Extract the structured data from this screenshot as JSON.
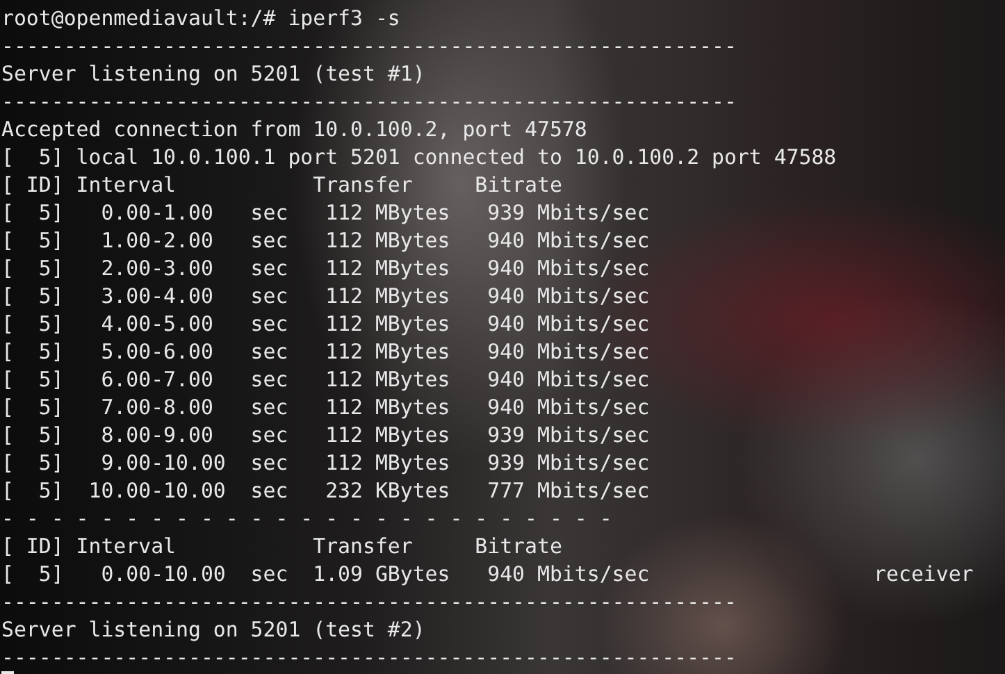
{
  "terminal": {
    "lines": [
      "root@openmediavault:/# iperf3 -s",
      "-----------------------------------------------------------",
      "Server listening on 5201 (test #1)",
      "-----------------------------------------------------------",
      "Accepted connection from 10.0.100.2, port 47578",
      "[  5] local 10.0.100.1 port 5201 connected to 10.0.100.2 port 47588",
      "[ ID] Interval           Transfer     Bitrate",
      "[  5]   0.00-1.00   sec   112 MBytes   939 Mbits/sec",
      "[  5]   1.00-2.00   sec   112 MBytes   940 Mbits/sec",
      "[  5]   2.00-3.00   sec   112 MBytes   940 Mbits/sec",
      "[  5]   3.00-4.00   sec   112 MBytes   940 Mbits/sec",
      "[  5]   4.00-5.00   sec   112 MBytes   940 Mbits/sec",
      "[  5]   5.00-6.00   sec   112 MBytes   940 Mbits/sec",
      "[  5]   6.00-7.00   sec   112 MBytes   940 Mbits/sec",
      "[  5]   7.00-8.00   sec   112 MBytes   940 Mbits/sec",
      "[  5]   8.00-9.00   sec   112 MBytes   939 Mbits/sec",
      "[  5]   9.00-10.00  sec   112 MBytes   939 Mbits/sec",
      "[  5]  10.00-10.00  sec   232 KBytes   777 Mbits/sec",
      "- - - - - - - - - - - - - - - - - - - - - - - - -",
      "[ ID] Interval           Transfer     Bitrate",
      "[  5]   0.00-10.00  sec  1.09 GBytes   940 Mbits/sec                  receiver",
      "-----------------------------------------------------------",
      "Server listening on 5201 (test #2)",
      "-----------------------------------------------------------"
    ]
  }
}
